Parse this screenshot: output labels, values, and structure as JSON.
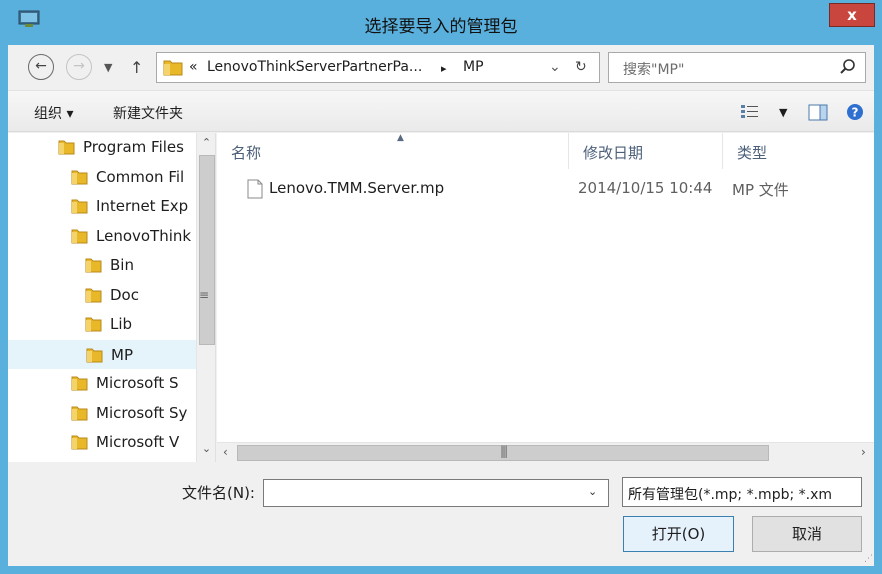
{
  "window": {
    "title": "选择要导入的管理包",
    "close_label": "x"
  },
  "address": {
    "overflow": "«",
    "path_parent": "LenovoThinkServerPartnerPa...",
    "separator": "▸",
    "current": "MP",
    "dropdown_glyph": "⌄",
    "refresh_glyph": "↻"
  },
  "search": {
    "placeholder": "搜索\"MP\""
  },
  "toolbar": {
    "organize": "组织 ▾",
    "new_folder": "新建文件夹"
  },
  "tree": [
    {
      "label": "Program Files",
      "indent": 1
    },
    {
      "label": "Common Fil",
      "indent": 2
    },
    {
      "label": "Internet Exp",
      "indent": 2
    },
    {
      "label": "LenovoThink",
      "indent": 2
    },
    {
      "label": "Bin",
      "indent": 3
    },
    {
      "label": "Doc",
      "indent": 3
    },
    {
      "label": "Lib",
      "indent": 3
    },
    {
      "label": "MP",
      "indent": 3,
      "selected": true
    },
    {
      "label": "Microsoft S",
      "indent": 2
    },
    {
      "label": "Microsoft Sy",
      "indent": 2
    },
    {
      "label": "Microsoft V",
      "indent": 2
    }
  ],
  "columns": {
    "name": "名称",
    "date": "修改日期",
    "type": "类型"
  },
  "files": [
    {
      "name": "Lenovo.TMM.Server.mp",
      "date": "2014/10/15 10:44",
      "type": "MP 文件"
    }
  ],
  "form": {
    "filename_label": "文件名(N):",
    "filename_value": "",
    "filter_value": "所有管理包(*.mp; *.mpb; *.xm"
  },
  "buttons": {
    "open": "打开(O)",
    "cancel": "取消"
  },
  "colors": {
    "titlebar": "#5ab0dd",
    "selection": "#e5f3fb",
    "close": "#c8463d",
    "folder": "#e8b829"
  }
}
